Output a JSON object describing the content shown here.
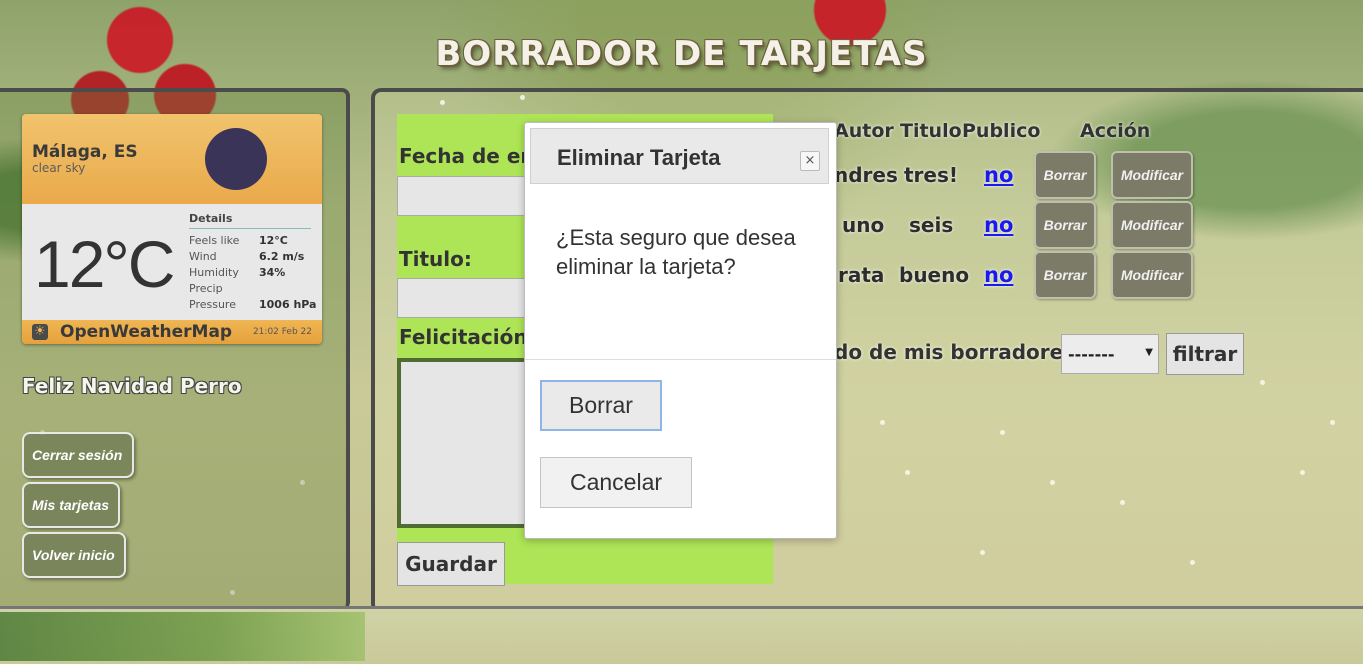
{
  "page": {
    "title": "BORRADOR DE TARJETAS"
  },
  "weather": {
    "city": "Málaga, ES",
    "description": "clear sky",
    "temperature": "12°C",
    "details_title": "Details",
    "rows": [
      {
        "label": "Feels like",
        "value": "12°C"
      },
      {
        "label": "Wind",
        "value": "6.2 m/s"
      },
      {
        "label": "Humidity",
        "value": "34%"
      },
      {
        "label": "Precip",
        "value": ""
      },
      {
        "label": "Pressure",
        "value": "1006 hPa"
      }
    ],
    "brand": "OpenWeatherMap",
    "timestamp": "21:02 Feb 22"
  },
  "sidebar": {
    "greeting": "Feliz Navidad Perro",
    "buttons": [
      {
        "label": "Cerrar sesión"
      },
      {
        "label": "Mis tarjetas"
      },
      {
        "label": "Volver inicio"
      }
    ]
  },
  "form": {
    "date_label": "Fecha de env",
    "title_label": "Titulo:",
    "message_label": "Felicitación:",
    "save_label": "Guardar"
  },
  "table": {
    "headers": [
      "Autor",
      "Titulo",
      "Publico",
      "Acción"
    ],
    "rows": [
      {
        "author": "ndres",
        "title": "tres!",
        "public": "no",
        "delete": "Borrar",
        "edit": "Modificar"
      },
      {
        "author": "uno",
        "title": "seis",
        "public": "no",
        "delete": "Borrar",
        "edit": "Modificar"
      },
      {
        "author": "rata",
        "title": "bueno",
        "public": "no",
        "delete": "Borrar",
        "edit": "Modificar"
      }
    ]
  },
  "filter": {
    "label": "do de mis borradores",
    "selected": "-------",
    "button": "filtrar"
  },
  "modal": {
    "title": "Eliminar Tarjeta",
    "close": "×",
    "message": "¿Esta seguro que desea eliminar la tarjeta?",
    "confirm": "Borrar",
    "cancel": "Cancelar"
  }
}
